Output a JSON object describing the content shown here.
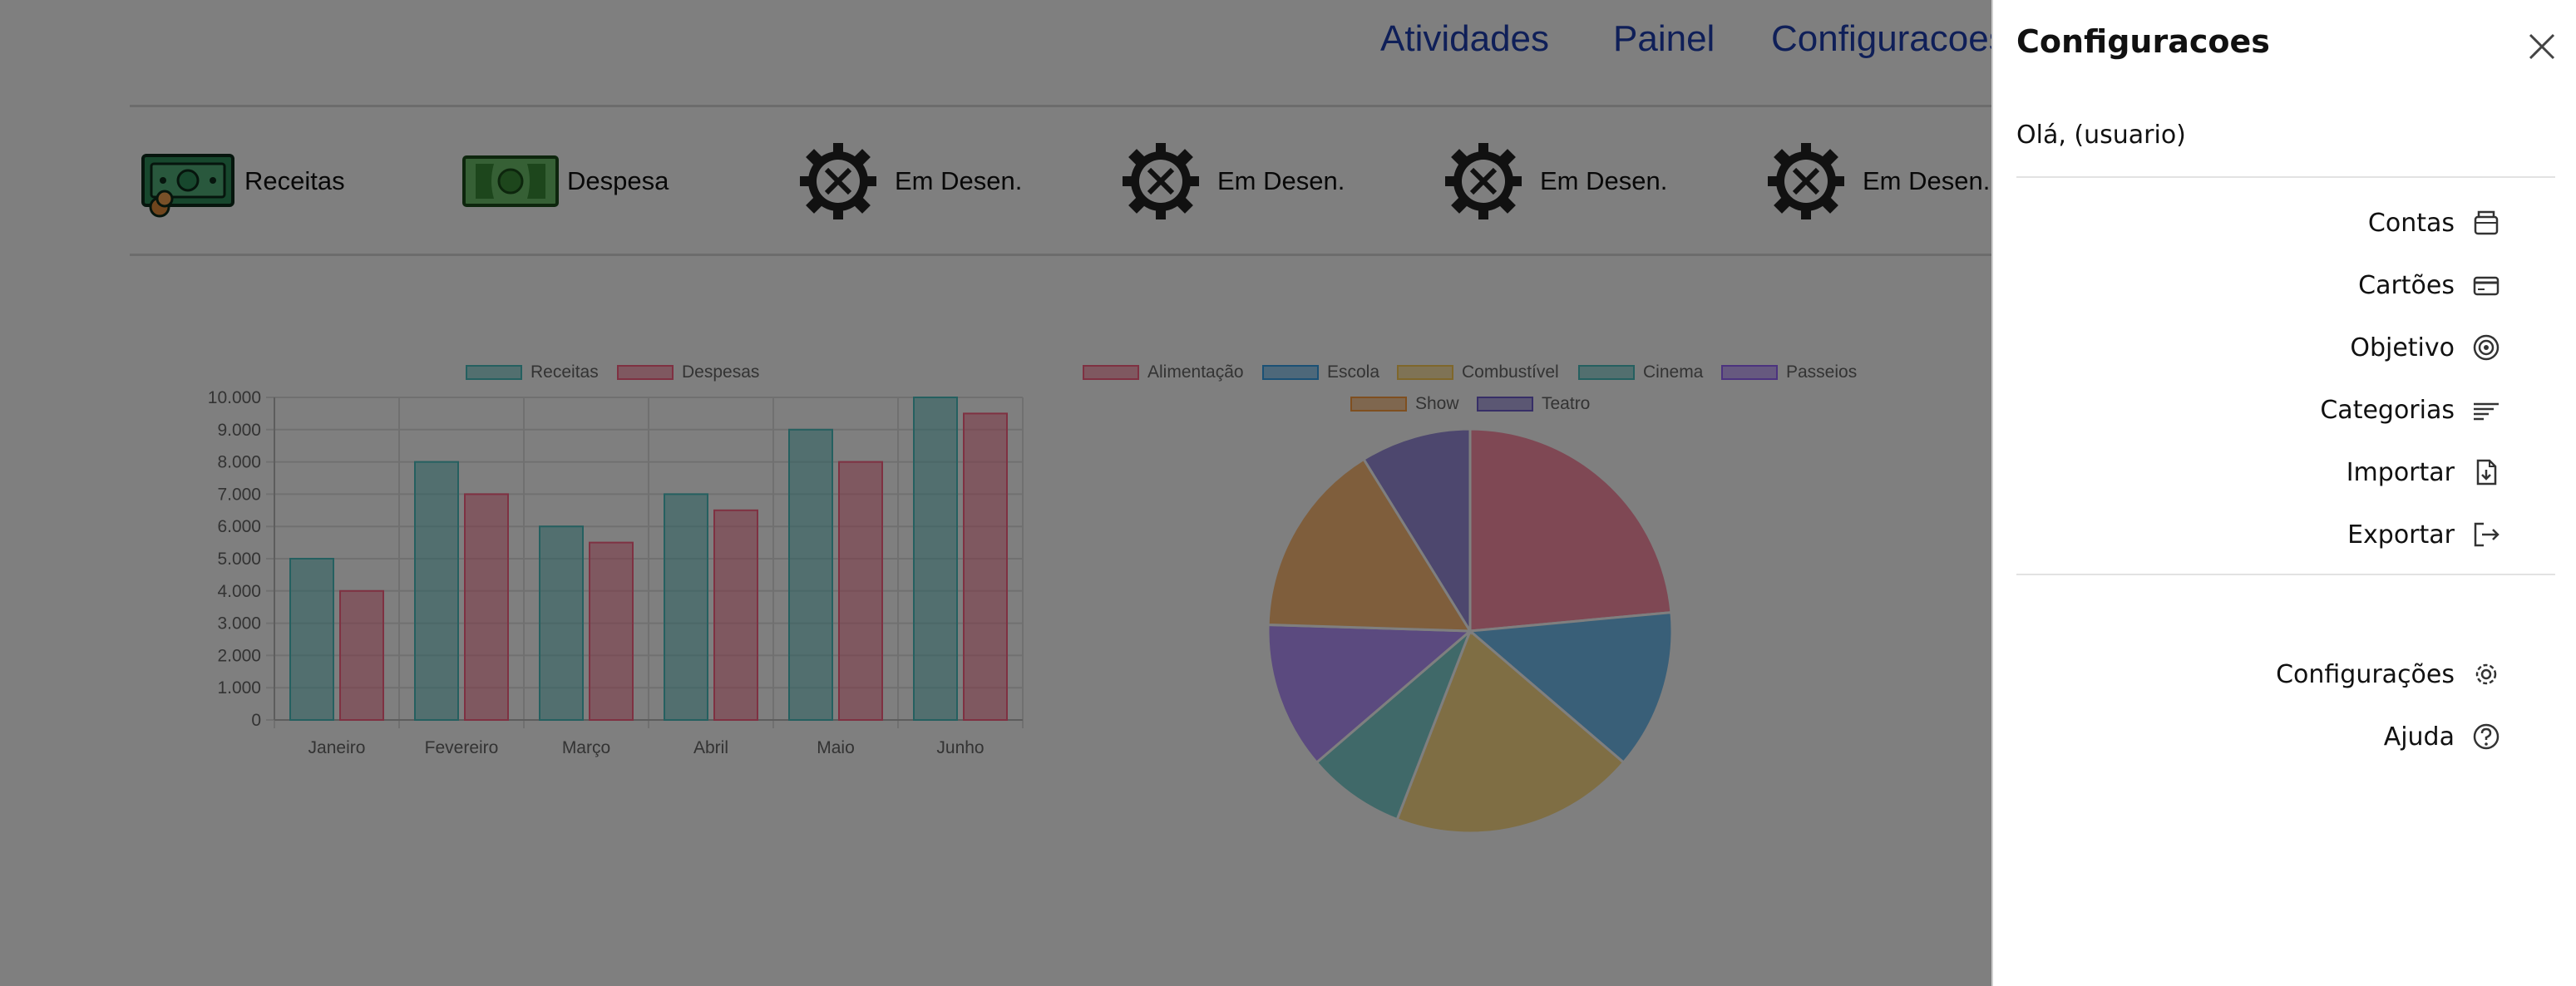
{
  "nav": {
    "links": [
      "Atividades",
      "Painel",
      "Configuracoes"
    ]
  },
  "categories": [
    {
      "label": "Receitas",
      "icon": "money-bill-coins-icon"
    },
    {
      "label": "Despesa",
      "icon": "money-bill-icon"
    },
    {
      "label": "Em Desen.",
      "icon": "gear-tools-icon"
    },
    {
      "label": "Em Desen.",
      "icon": "gear-tools-icon"
    },
    {
      "label": "Em Desen.",
      "icon": "gear-tools-icon"
    },
    {
      "label": "Em Desen.",
      "icon": "gear-tools-icon"
    }
  ],
  "chart_data": [
    {
      "type": "bar",
      "categories": [
        "Janeiro",
        "Fevereiro",
        "Março",
        "Abril",
        "Maio",
        "Junho"
      ],
      "series": [
        {
          "name": "Receitas",
          "values": [
            5000,
            8000,
            6000,
            7000,
            9000,
            10000
          ],
          "color": "#4bc0c0"
        },
        {
          "name": "Despesas",
          "values": [
            4000,
            7000,
            5500,
            6500,
            8000,
            9500
          ],
          "color": "#ff6384"
        }
      ],
      "yticks": [
        "0",
        "1.000",
        "2.000",
        "3.000",
        "4.000",
        "5.000",
        "6.000",
        "7.000",
        "8.000",
        "9.000",
        "10.000"
      ],
      "ylim": [
        0,
        10000
      ],
      "grid": true,
      "legend": "top"
    },
    {
      "type": "pie",
      "categories": [
        "Alimentação",
        "Escola",
        "Combustível",
        "Cinema",
        "Passeios",
        "Show",
        "Teatro"
      ],
      "values": [
        24,
        13,
        20,
        8,
        12,
        16,
        9
      ],
      "colors": [
        "#ff6384",
        "#36a2eb",
        "#ffce56",
        "#4bc0c0",
        "#9966ff",
        "#ff9f40",
        "#6f5fcf"
      ],
      "legend": "top"
    }
  ],
  "panel": {
    "title": "Configuracoes",
    "greeting": "Olá, (usuario)",
    "menu": [
      {
        "label": "Contas",
        "icon": "wallet-icon"
      },
      {
        "label": "Cartões",
        "icon": "credit-card-icon"
      },
      {
        "label": "Objetivo",
        "icon": "target-icon"
      },
      {
        "label": "Categorias",
        "icon": "list-icon"
      },
      {
        "label": "Importar",
        "icon": "import-file-icon"
      },
      {
        "label": "Exportar",
        "icon": "export-icon"
      }
    ],
    "footer_menu": [
      {
        "label": "Configurações",
        "icon": "gear-icon"
      },
      {
        "label": "Ajuda",
        "icon": "help-icon"
      }
    ]
  },
  "colors": {
    "nav_link": "#1f3fb0",
    "overlay": "rgba(0,0,0,0.5)"
  }
}
